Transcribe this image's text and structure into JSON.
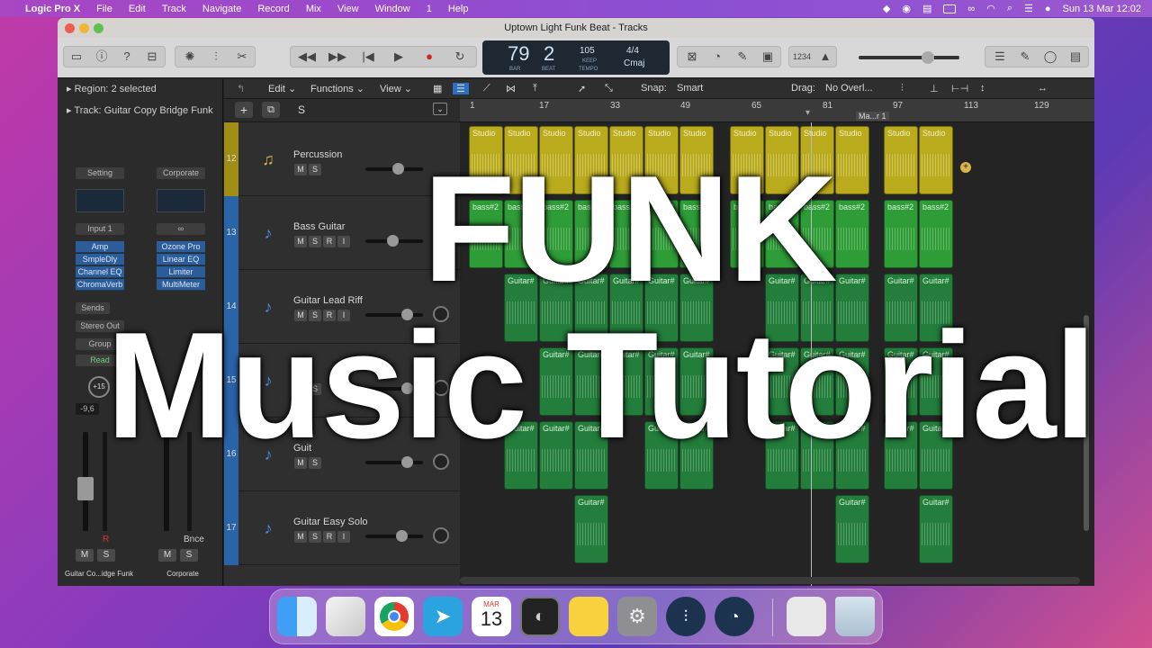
{
  "menubar": {
    "app_name": "Logic Pro X",
    "items": [
      "File",
      "Edit",
      "Track",
      "Navigate",
      "Record",
      "Mix",
      "View",
      "Window",
      "1",
      "Help"
    ],
    "datetime": "Sun 13 Mar  12:02"
  },
  "window": {
    "title": "Uptown Light Funk Beat - Tracks"
  },
  "lcd": {
    "bar": "79",
    "beat": "2",
    "bar_label": "BAR",
    "beat_label": "BEAT",
    "tempo": "105",
    "tempo_mode": "KEEP",
    "tempo_label": "TEMPO",
    "signature": "4/4",
    "key": "Cmaj"
  },
  "toolbar": {
    "count_in": "1234"
  },
  "inspector": {
    "region_label": "Region:",
    "region_value": "2 selected",
    "track_label": "Track:",
    "track_value": "Guitar Copy Bridge Funk",
    "strip1": {
      "setting": "Setting",
      "input": "Input 1",
      "plugins": [
        "Amp",
        "SmpleDly",
        "Channel EQ",
        "ChromaVerb"
      ],
      "sends": "Sends",
      "output": "Stereo Out",
      "group": "Group",
      "automation": "Read",
      "pan": "+15",
      "volume": "-9,6",
      "name": "Guitar Co...idge Funk"
    },
    "strip2": {
      "setting": "Corporate",
      "plugins": [
        "Ozone Pro",
        "Linear EQ",
        "Limiter",
        "MultiMeter"
      ],
      "bounce": "Bnce",
      "name": "Corporate"
    }
  },
  "trackarea": {
    "menus": [
      "Edit",
      "Functions",
      "View"
    ],
    "snap_label": "Snap:",
    "snap_value": "Smart",
    "drag_label": "Drag:",
    "drag_value": "No Overl..."
  },
  "ruler": {
    "bars": [
      "1",
      "17",
      "33",
      "49",
      "65",
      "81",
      "97",
      "113",
      "129"
    ],
    "marker": "Ma...r 1"
  },
  "tracks": [
    {
      "number": "12",
      "name": "Percussion",
      "region_label": "Studio",
      "color": "#b9ab1c"
    },
    {
      "number": "13",
      "name": "Bass Guitar",
      "region_label": "bass#2",
      "color": "#2e9d37"
    },
    {
      "number": "14",
      "name": "Guitar Lead Riff",
      "region_label": "Guitar#",
      "color": "#237d3b"
    },
    {
      "number": "15",
      "name": "Gui",
      "region_label": "Guitar#",
      "color": "#237d3b"
    },
    {
      "number": "16",
      "name": "Guit",
      "region_label": "Guitar#",
      "color": "#237d3b"
    },
    {
      "number": "17",
      "name": "Guitar Easy Solo",
      "region_label": "Guitar#",
      "color": "#237d3b"
    }
  ],
  "overlay": {
    "line1": "FUNK",
    "line2": "Music Tutorial"
  },
  "dock": {
    "calendar_month": "MAR",
    "calendar_day": "13"
  }
}
